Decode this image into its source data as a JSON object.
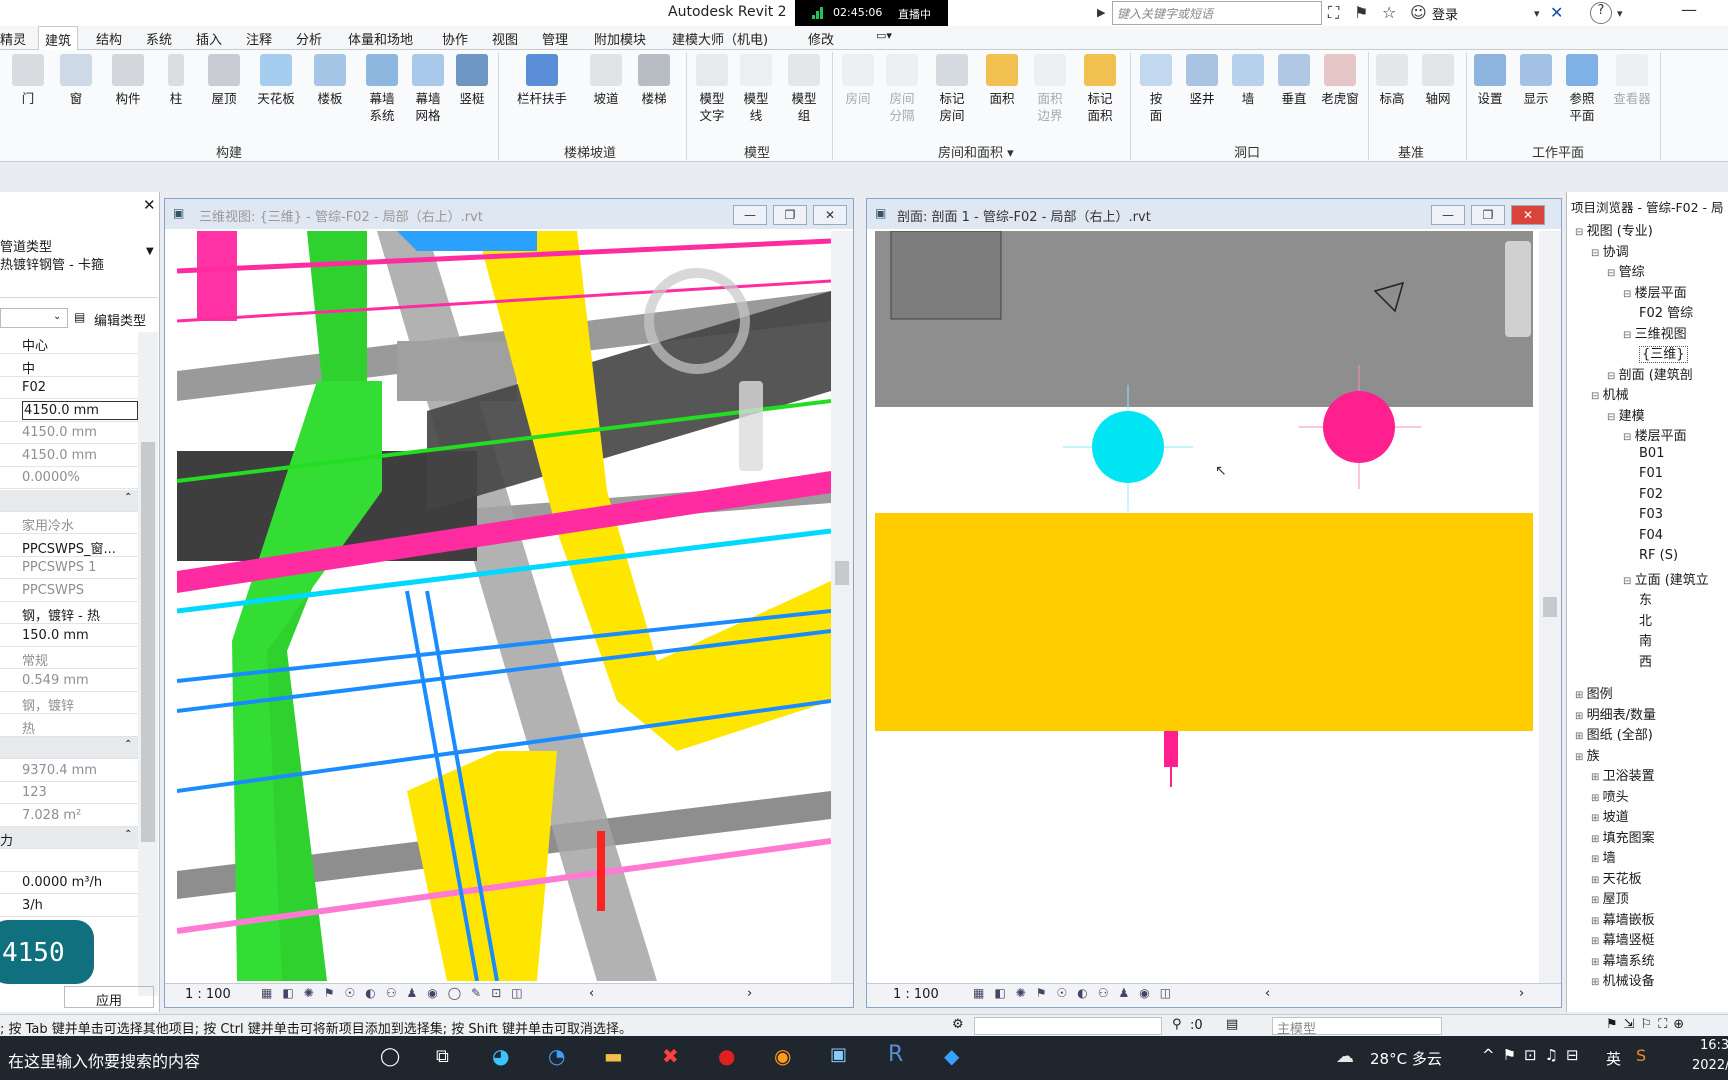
{
  "app": {
    "title": "Autodesk Revit 2",
    "live_time": "02:45:06",
    "live_label": "直播中",
    "search_placeholder": "键入关键字或短语",
    "signin": "登录"
  },
  "tabs": [
    "精灵",
    "建筑",
    "结构",
    "系统",
    "插入",
    "注释",
    "分析",
    "体量和场地",
    "协作",
    "视图",
    "管理",
    "附加模块",
    "建模大师（机电)",
    "修改"
  ],
  "active_tab": "建筑",
  "ribbon": {
    "build": [
      "门",
      "窗",
      "构件",
      "柱",
      "屋顶",
      "天花板",
      "楼板",
      "幕墙\n系统",
      "幕墙\n网格",
      "竖梃"
    ],
    "stairs": [
      "栏杆扶手",
      "坡道",
      "楼梯"
    ],
    "model": [
      "模型\n文字",
      "模型\n线",
      "模型\n组"
    ],
    "room": [
      "房间",
      "房间\n分隔",
      "标记\n房间",
      "面积",
      "面积\n边界",
      "标记\n面积"
    ],
    "opening": [
      "按\n面",
      "竖井",
      "墙",
      "垂直",
      "老虎窗"
    ],
    "datum": [
      "标高",
      "轴网"
    ],
    "workplane": [
      "设置",
      "显示",
      "参照\n平面",
      "查看器"
    ],
    "panels": [
      "构建",
      "楼梯坡道",
      "模型",
      "房间和面积 ▾",
      "洞口",
      "基准",
      "工作平面"
    ]
  },
  "properties": {
    "type_line1": "管道类型",
    "type_line2": "热镀锌钢管 - 卡箍",
    "edit_type": "编辑类型",
    "rows": [
      "中心",
      "中",
      "F02",
      "4150.0 mm",
      "4150.0 mm",
      "4150.0 mm",
      "0.0000%",
      "",
      "家用冷水",
      "PPCSWPS_窗...",
      "PPCSWPS 1",
      "PPCSWPS",
      "钢，镀锌 - 热",
      "150.0 mm",
      "常规",
      "0.549 mm",
      "钢，镀锌",
      "热",
      "",
      "9370.4 mm",
      "123",
      "7.028 m²",
      "",
      "",
      "0.0000 m³/h",
      "3/h"
    ],
    "label_stub": "力",
    "apply": "应用"
  },
  "overlay_value": "4150",
  "views": {
    "view3d_title": "三维视图: {三维} - 管综-F02 - 局部（右上）.rvt",
    "section_title": "剖面: 剖面 1 - 管综-F02 - 局部（右上）.rvt",
    "scale": "1 : 100"
  },
  "browser": {
    "title": "项目浏览器 - 管综-F02 - 局",
    "items": [
      "视图 (专业)",
      "协调",
      "管综",
      "楼层平面",
      "F02 管综",
      "三维视图",
      "{三维}",
      "剖面 (建筑剖",
      "机械",
      "建模",
      "楼层平面",
      "B01",
      "F01",
      "F02",
      "F03",
      "F04",
      "RF (S)",
      "立面 (建筑立",
      "东",
      "北",
      "南",
      "西",
      "图例",
      "明细表/数量",
      "图纸 (全部)",
      "族",
      "卫浴装置",
      "喷头",
      "坡道",
      "填充图案",
      "墙",
      "天花板",
      "屋顶",
      "幕墙嵌板",
      "幕墙竖梃",
      "幕墙系统",
      "机械设备"
    ]
  },
  "status": {
    "hint": "; 按 Tab 键并单击可选择其他项目; 按 Ctrl 键并单击可将新项目添加到选择集; 按 Shift 键并单击可取消选择。",
    "sel_count": ":0",
    "model": "主模型"
  },
  "taskbar": {
    "search": "在这里输入你要搜索的内容",
    "weather": "28°C 多云",
    "lang": "英",
    "time": "16:3",
    "date": "2022/"
  },
  "colors": {
    "cyan": "#00e5f2",
    "magenta": "#ff1f8e",
    "yellow": "#ffd200",
    "green": "#22dd22",
    "concrete": "#8e8e8e"
  }
}
